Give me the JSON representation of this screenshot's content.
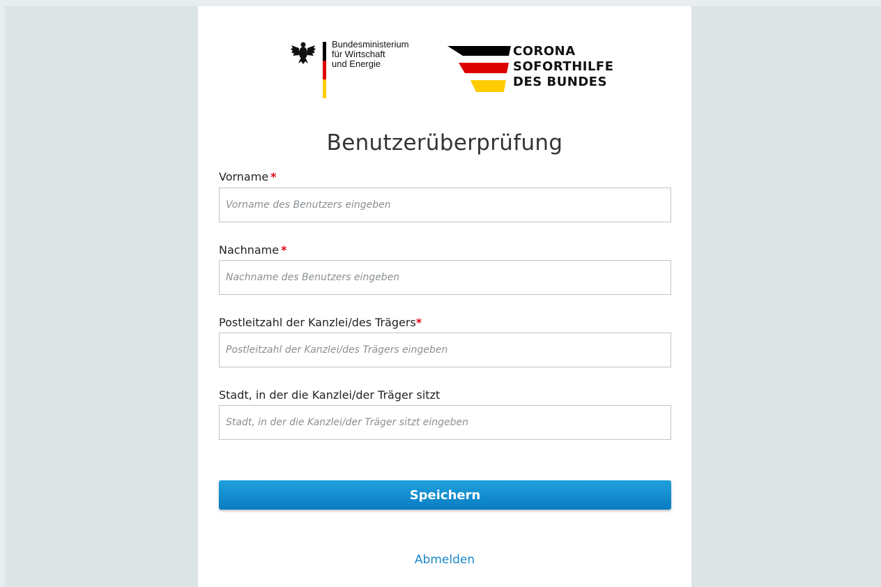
{
  "colors": {
    "accent": "#1589cf",
    "required": "#e2061b",
    "flag_black": "#000000",
    "flag_red": "#dd0000",
    "flag_gold": "#ffcc00"
  },
  "logos": {
    "bmwi_lines": [
      "Bundesministerium",
      "für Wirtschaft",
      "und Energie"
    ],
    "corona_lines": [
      "CORONA",
      "SOFORTHILFE",
      "DES BUNDES"
    ]
  },
  "page_title": "Benutzerüberprüfung",
  "form": {
    "first_name": {
      "label": "Vorname",
      "required_mark": "*",
      "value": "",
      "placeholder": "Vorname des Benutzers eingeben"
    },
    "last_name": {
      "label": "Nachname",
      "required_mark": "*",
      "value": "",
      "placeholder": "Nachname des Benutzers eingeben"
    },
    "postal_code": {
      "label": "Postleitzahl der Kanzlei/des Trägers",
      "required_mark": "*",
      "value": "",
      "placeholder": "Postleitzahl der Kanzlei/des Trägers eingeben"
    },
    "city": {
      "label": "Stadt, in der die Kanzlei/der Träger sitzt",
      "value": "",
      "placeholder": "Stadt, in der die Kanzlei/der Träger sitzt eingeben"
    }
  },
  "actions": {
    "save_label": "Speichern",
    "logout_label": "Abmelden"
  }
}
